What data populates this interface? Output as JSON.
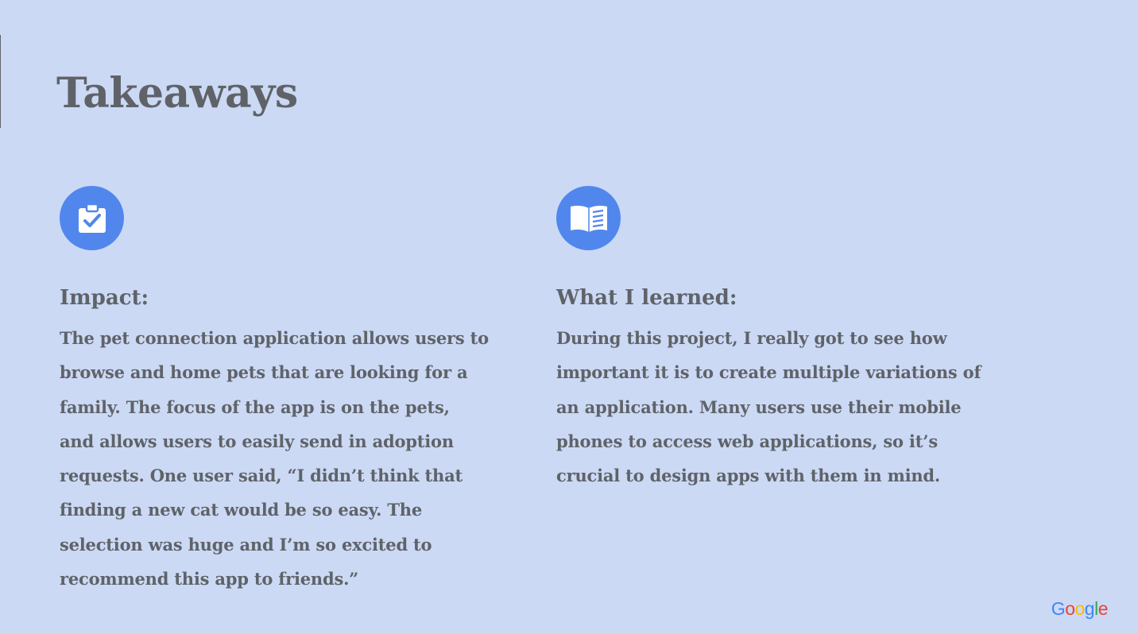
{
  "slide": {
    "title": "Takeaways"
  },
  "columns": [
    {
      "icon": "clipboard-check-icon",
      "heading": "Impact:",
      "body": "The pet connection application allows users to browse and home pets that are looking for a family.  The focus of the app is on the pets, and allows users to easily send in adoption requests. One user said, “I didn’t think that finding a new cat would be so easy. The selection was huge and I’m so excited to recommend this app to friends.”"
    },
    {
      "icon": "open-book-icon",
      "heading": "What I learned:",
      "body": "During this project, I really got to see how important it is to create multiple variations of an application. Many users use their mobile phones to access web applications, so it’s crucial to design apps with them in mind."
    }
  ],
  "footer": {
    "logo_letters": [
      "G",
      "o",
      "o",
      "g",
      "l",
      "e"
    ],
    "logo_colors": [
      "#4285f4",
      "#ea4335",
      "#fbbc05",
      "#4285f4",
      "#34a853",
      "#ea4335"
    ]
  },
  "colors": {
    "background": "#cbd9f5",
    "accent": "#5187ec",
    "text": "#5f6368"
  }
}
